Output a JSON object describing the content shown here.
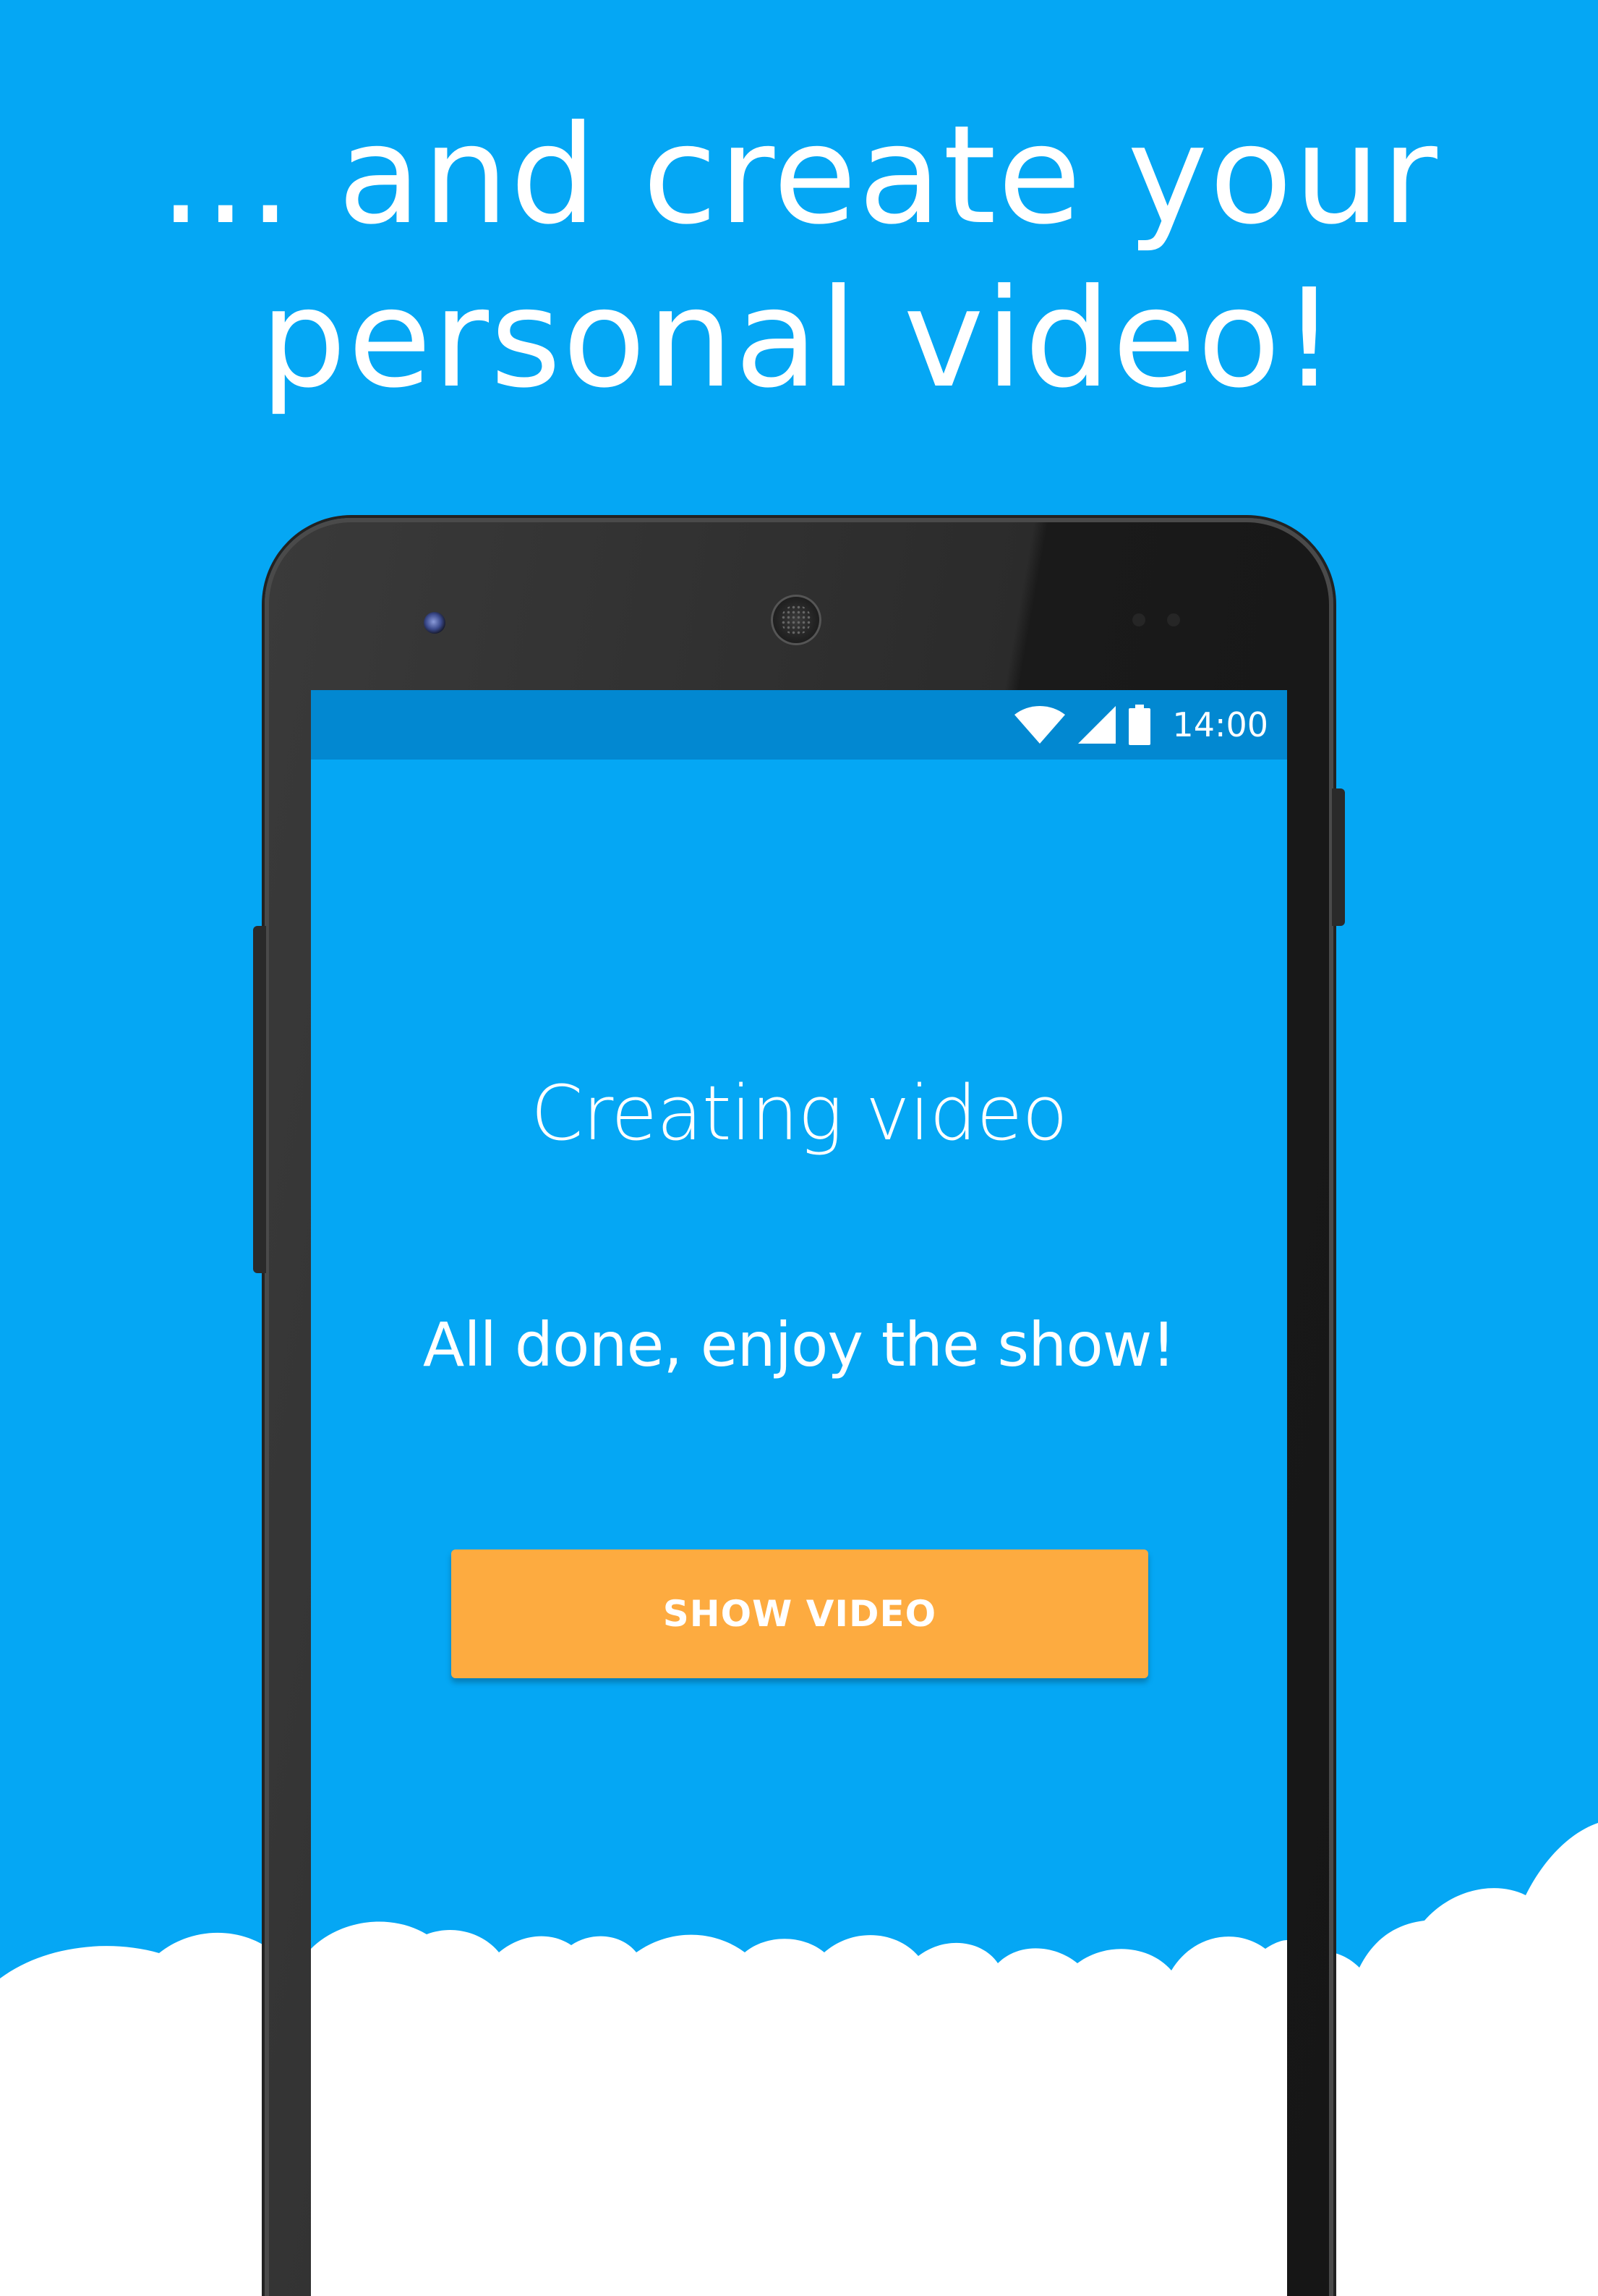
{
  "promo": {
    "headline_line1": "... and create your",
    "headline_line2": "personal video!"
  },
  "status_bar": {
    "time": "14:00",
    "icons": [
      "wifi-icon",
      "cell-signal-icon",
      "battery-icon"
    ]
  },
  "screen": {
    "title": "Creating video",
    "message": "All done, enjoy the show!",
    "button_label": "SHOW VIDEO"
  },
  "colors": {
    "background": "#05a7f4",
    "status_bar": "#0288d1",
    "button": "#fdab40",
    "text": "#ffffff",
    "clouds": "#ffffff"
  }
}
